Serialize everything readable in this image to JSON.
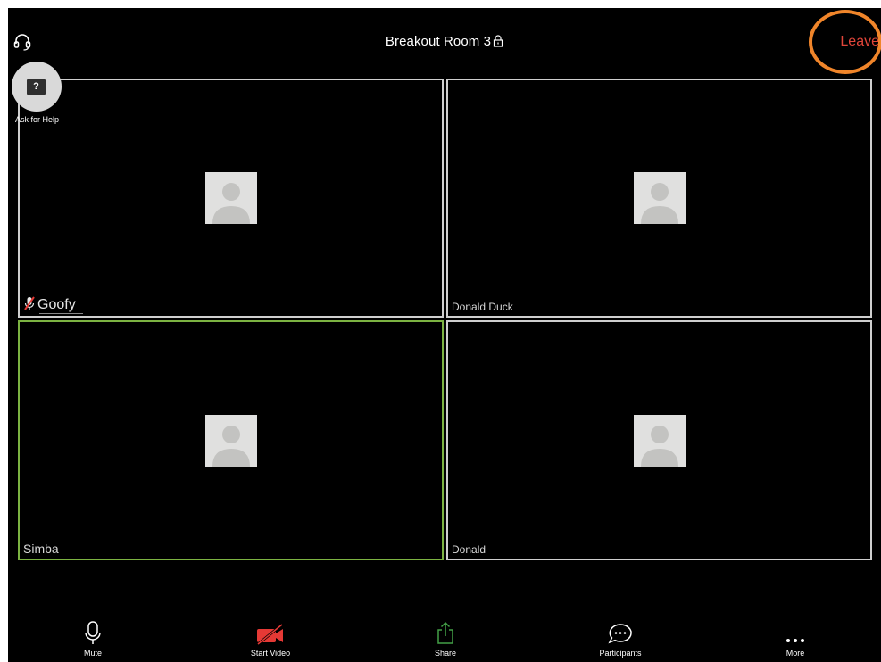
{
  "header": {
    "room_title": "Breakout Room 3",
    "leave_label": "Leave"
  },
  "help": {
    "label": "Ask for Help",
    "icon_glyph": "?"
  },
  "participants": [
    {
      "name": "Goofy",
      "muted": true,
      "active_speaker": false
    },
    {
      "name": "Donald Duck",
      "muted": false,
      "active_speaker": false
    },
    {
      "name": "Simba",
      "muted": false,
      "active_speaker": true
    },
    {
      "name": "Donald",
      "muted": false,
      "active_speaker": false
    }
  ],
  "toolbar": {
    "mute_label": "Mute",
    "start_video_label": "Start Video",
    "share_label": "Share",
    "participants_label": "Participants",
    "more_label": "More"
  },
  "colors": {
    "background": "#000000",
    "leave_text": "#e0453a",
    "leave_highlight": "#f0852a",
    "active_speaker_border": "#7cb342",
    "video_off": "#e53935",
    "share_green": "#43a047"
  },
  "icons": {
    "audio": "headset-icon",
    "lock": "lock-icon",
    "help": "help-screen-icon",
    "avatar": "person-placeholder-icon",
    "muted": "muted-mic-icon",
    "mute": "microphone-icon",
    "video": "video-off-icon",
    "share": "share-icon",
    "participants": "chat-bubble-icon",
    "more": "more-dots-icon"
  }
}
